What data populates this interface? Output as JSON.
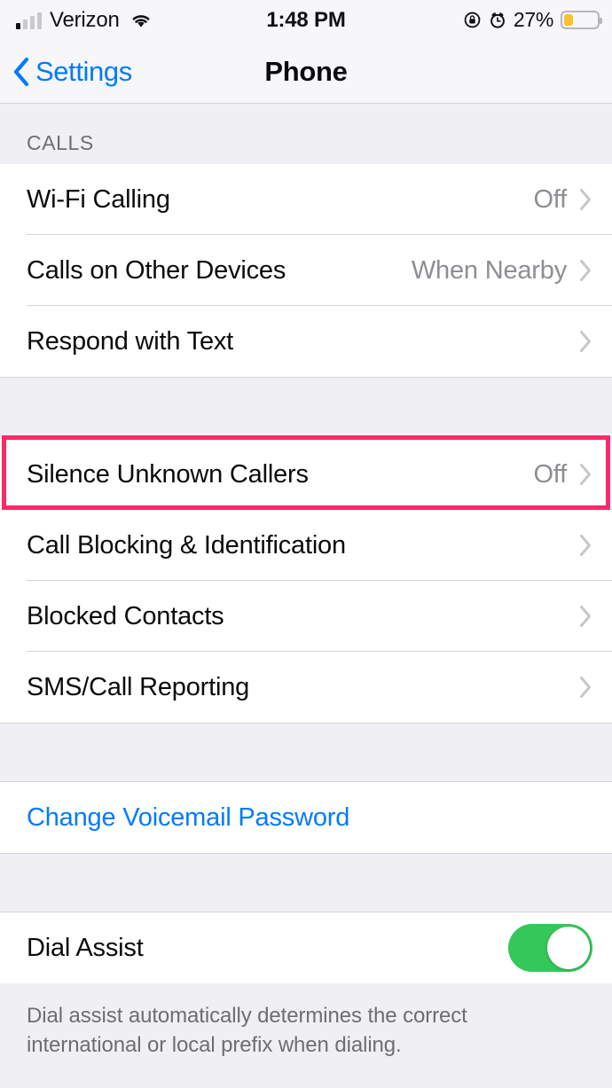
{
  "status_bar": {
    "carrier": "Verizon",
    "signal_icon": "cellular-signal-icon",
    "signal_bars_total": 4,
    "signal_bars_filled": 1,
    "wifi_icon": "wifi-icon",
    "time": "1:48 PM",
    "rotation_lock_icon": "rotation-lock-icon",
    "alarm_icon": "alarm-clock-icon",
    "battery_percent": "27%",
    "battery_fill_ratio": 27,
    "battery_color": "#fbc02d"
  },
  "nav": {
    "back_icon": "chevron-left-icon",
    "back_label": "Settings",
    "title": "Phone",
    "tint_color": "#007aff"
  },
  "sections": [
    {
      "header": "CALLS",
      "rows": [
        {
          "label": "Wi-Fi Calling",
          "value": "Off",
          "accessory": "chevron-right-icon"
        },
        {
          "label": "Calls on Other Devices",
          "value": "When Nearby",
          "accessory": "chevron-right-icon"
        },
        {
          "label": "Respond with Text",
          "value": "",
          "accessory": "chevron-right-icon"
        }
      ]
    },
    {
      "header": "",
      "rows": [
        {
          "label": "Silence Unknown Callers",
          "value": "Off",
          "accessory": "chevron-right-icon",
          "highlighted": true
        },
        {
          "label": "Call Blocking & Identification",
          "value": "",
          "accessory": "chevron-right-icon"
        },
        {
          "label": "Blocked Contacts",
          "value": "",
          "accessory": "chevron-right-icon"
        },
        {
          "label": "SMS/Call Reporting",
          "value": "",
          "accessory": "chevron-right-icon"
        }
      ]
    },
    {
      "header": "",
      "rows": [
        {
          "label": "Change Voicemail Password",
          "value": "",
          "accessory": "none",
          "style": "link"
        }
      ]
    },
    {
      "header": "",
      "rows": [
        {
          "label": "Dial Assist",
          "value": "",
          "accessory": "switch",
          "switch_on": true
        }
      ],
      "footer": "Dial assist automatically determines the correct international or local prefix when dialing."
    }
  ],
  "colors": {
    "accent": "#007aff",
    "highlight": "#fa2a68",
    "switch_on": "#34c759",
    "secondary_text": "#8e8e93",
    "group_background": "#efeff4",
    "row_background": "#ffffff",
    "separator": "#d4d4d8"
  },
  "labels": {
    "group1_header": "CALLS",
    "row_wifi_calling": "Wi-Fi Calling",
    "row_wifi_calling_value": "Off",
    "row_calls_other_devices": "Calls on Other Devices",
    "row_calls_other_devices_value": "When Nearby",
    "row_respond_with_text": "Respond with Text",
    "row_silence_unknown": "Silence Unknown Callers",
    "row_silence_unknown_value": "Off",
    "row_call_blocking": "Call Blocking & Identification",
    "row_blocked_contacts": "Blocked Contacts",
    "row_sms_call_reporting": "SMS/Call Reporting",
    "row_change_voicemail_password": "Change Voicemail Password",
    "row_dial_assist": "Dial Assist",
    "footer_dial_assist": "Dial assist automatically determines the correct international or local prefix when dialing."
  }
}
